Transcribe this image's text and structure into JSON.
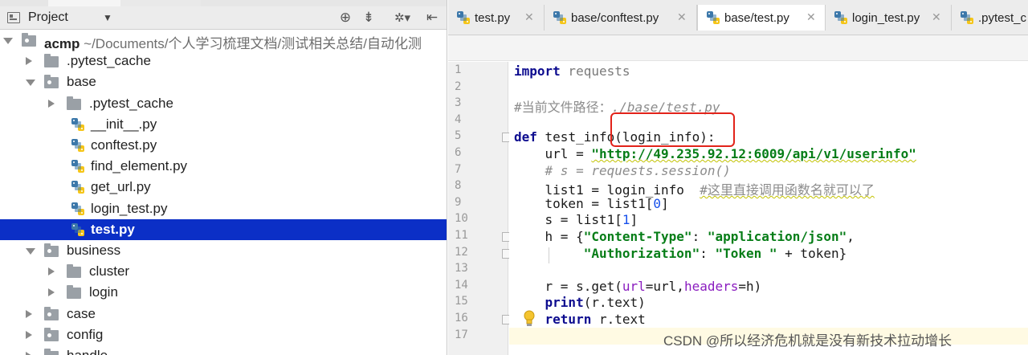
{
  "project_panel": {
    "title": "Project",
    "dropdown": "▼",
    "buttons": {
      "target": "⊕",
      "collapse": "⇟",
      "settings": "✲▾",
      "hide": "⇤"
    },
    "tree": [
      {
        "label": "acmp",
        "hint": "~/Documents/个人学习梳理文档/测试相关总结/自动化测",
        "type": "folder",
        "state": "expanded",
        "depth": 0,
        "bold": true
      },
      {
        "label": ".pytest_cache",
        "type": "folder",
        "state": "collapsed",
        "depth": 1
      },
      {
        "label": "base",
        "type": "folder",
        "state": "expanded",
        "depth": 1
      },
      {
        "label": ".pytest_cache",
        "type": "folder",
        "state": "collapsed",
        "depth": 2
      },
      {
        "label": "__init__.py",
        "type": "pyfile",
        "depth": 2
      },
      {
        "label": "conftest.py",
        "type": "pyfile",
        "depth": 2
      },
      {
        "label": "find_element.py",
        "type": "pyfile",
        "depth": 2
      },
      {
        "label": "get_url.py",
        "type": "pyfile",
        "depth": 2
      },
      {
        "label": "login_test.py",
        "type": "pyfile",
        "depth": 2
      },
      {
        "label": "test.py",
        "type": "pyfile",
        "depth": 2,
        "selected": true
      },
      {
        "label": "business",
        "type": "folder",
        "state": "expanded",
        "depth": 1
      },
      {
        "label": "cluster",
        "type": "folder",
        "state": "collapsed",
        "depth": 2
      },
      {
        "label": "login",
        "type": "folder",
        "state": "collapsed",
        "depth": 2
      },
      {
        "label": "case",
        "type": "folder",
        "state": "collapsed",
        "depth": 1
      },
      {
        "label": "config",
        "type": "folder",
        "state": "collapsed",
        "depth": 1
      },
      {
        "label": "handle",
        "type": "folder",
        "state": "collapsed",
        "depth": 1
      }
    ]
  },
  "editor": {
    "tabs": [
      {
        "label": "test.py",
        "close": "✕",
        "active": false
      },
      {
        "label": "base/conftest.py",
        "close": "✕",
        "active": false
      },
      {
        "label": "base/test.py",
        "close": "✕",
        "active": true
      },
      {
        "label": "login_test.py",
        "close": "✕",
        "active": false
      },
      {
        "label": ".pytest_c",
        "close": "",
        "active": false
      }
    ],
    "line_numbers": [
      "1",
      "2",
      "3",
      "4",
      "5",
      "6",
      "7",
      "8",
      "9",
      "10",
      "11",
      "12",
      "13",
      "14",
      "15",
      "16",
      "17"
    ],
    "current_line": 17,
    "highlight_annotation": "(login_info):",
    "lines": [
      [
        {
          "t": "import",
          "c": "kw"
        },
        {
          "t": " requests",
          "c": "plain-gray"
        }
      ],
      [],
      [
        {
          "t": "#当前文件路径：",
          "c": "cmt-plain"
        },
        {
          "t": "./base/test.py",
          "c": "cmt"
        }
      ],
      [],
      [
        {
          "t": "def",
          "c": "kw"
        },
        {
          "t": " test_info(login_info):",
          "c": ""
        }
      ],
      [
        {
          "t": "    url = ",
          "c": ""
        },
        {
          "t": "\"http://49.235.92.12:6009/api/v1/userinfo\"",
          "c": "str squiggle"
        }
      ],
      [
        {
          "t": "    # s = requests.session()",
          "c": "cmt"
        }
      ],
      [
        {
          "t": "    list1 = login_info  ",
          "c": ""
        },
        {
          "t": "#这里直接调用函数名就可以了",
          "c": "cmt-plain squiggle"
        }
      ],
      [
        {
          "t": "    token = list1[",
          "c": ""
        },
        {
          "t": "0",
          "c": "num"
        },
        {
          "t": "]",
          "c": ""
        }
      ],
      [
        {
          "t": "    s = list1[",
          "c": ""
        },
        {
          "t": "1",
          "c": "num"
        },
        {
          "t": "]",
          "c": ""
        }
      ],
      [
        {
          "t": "    h = {",
          "c": ""
        },
        {
          "t": "\"Content-Type\"",
          "c": "str"
        },
        {
          "t": ": ",
          "c": ""
        },
        {
          "t": "\"application/json\"",
          "c": "str"
        },
        {
          "t": ",",
          "c": ""
        }
      ],
      [
        {
          "t": "         ",
          "c": ""
        },
        {
          "t": "\"Authorization\"",
          "c": "str"
        },
        {
          "t": ": ",
          "c": ""
        },
        {
          "t": "\"Token \"",
          "c": "str"
        },
        {
          "t": " + token}",
          "c": ""
        }
      ],
      [],
      [
        {
          "t": "    r = s.get(",
          "c": ""
        },
        {
          "t": "url",
          "c": "named"
        },
        {
          "t": "=url,",
          "c": ""
        },
        {
          "t": "headers",
          "c": "named"
        },
        {
          "t": "=h)",
          "c": ""
        }
      ],
      [
        {
          "t": "    ",
          "c": ""
        },
        {
          "t": "print",
          "c": "kw"
        },
        {
          "t": "(r.text)",
          "c": ""
        }
      ],
      [
        {
          "t": "    ",
          "c": ""
        },
        {
          "t": "return",
          "c": "kw"
        },
        {
          "t": " r.text",
          "c": ""
        }
      ],
      []
    ]
  },
  "watermark": "CSDN @所以经济危机就是没有新技术拉动增长",
  "colors": {
    "selection": "#0b2fc6",
    "keyword": "#0d0c8f",
    "string": "#067d17",
    "comment": "#8c8c8c",
    "number": "#1750eb",
    "annotation_box": "#e2231a",
    "current_line": "#fffae3"
  }
}
